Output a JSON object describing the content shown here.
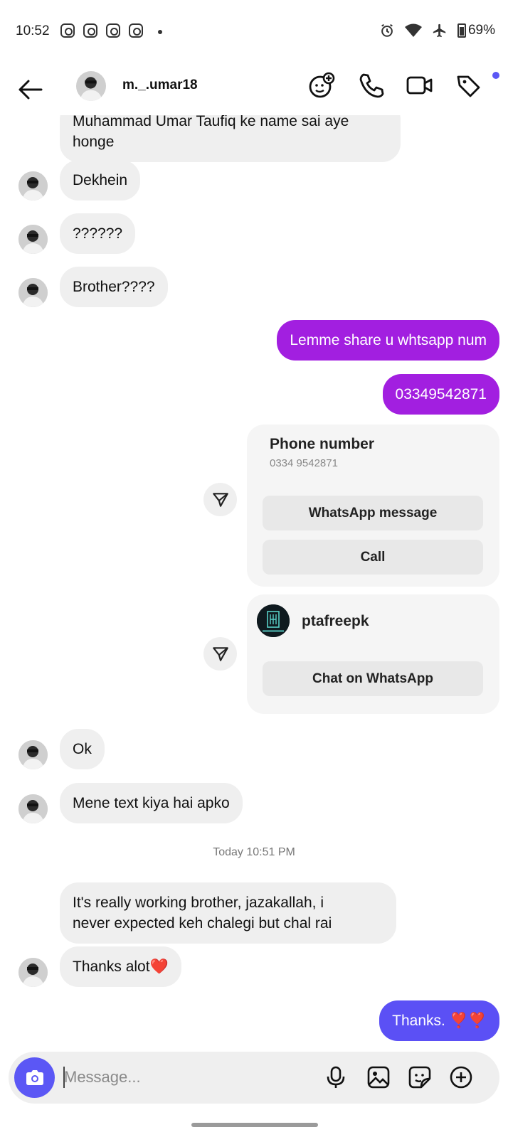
{
  "status_bar": {
    "time": "10:52",
    "battery": "69%"
  },
  "header": {
    "username": "m._.umar18"
  },
  "messages": {
    "m1": "Muhammad Umar Taufiq ke name sai aye\nhonge",
    "m2": "Dekhein",
    "m3": "??????",
    "m4": "Brother????",
    "m5": "Lemme share u whtsapp num",
    "m6": "03349542871",
    "m7": "Ok",
    "m8": "Mene text kiya hai apko",
    "m9": "It's really working brother, jazakallah, i\nnever expected keh chalegi but chal rai",
    "m10": "Thanks alot❤️",
    "m11": "Thanks. ❣️❣️"
  },
  "phone_card": {
    "title": "Phone number",
    "number": "0334 9542871",
    "whatsapp_label": "WhatsApp message",
    "call_label": "Call"
  },
  "business_card": {
    "name": "ptafreepk",
    "chat_label": "Chat on WhatsApp"
  },
  "timestamp": "Today 10:51 PM",
  "composer": {
    "placeholder": "Message..."
  },
  "colors": {
    "outgoing_purple": "#a21fe0",
    "outgoing_indigo": "#5b50f5",
    "accent": "#5b57f5",
    "incoming": "#efefef"
  }
}
